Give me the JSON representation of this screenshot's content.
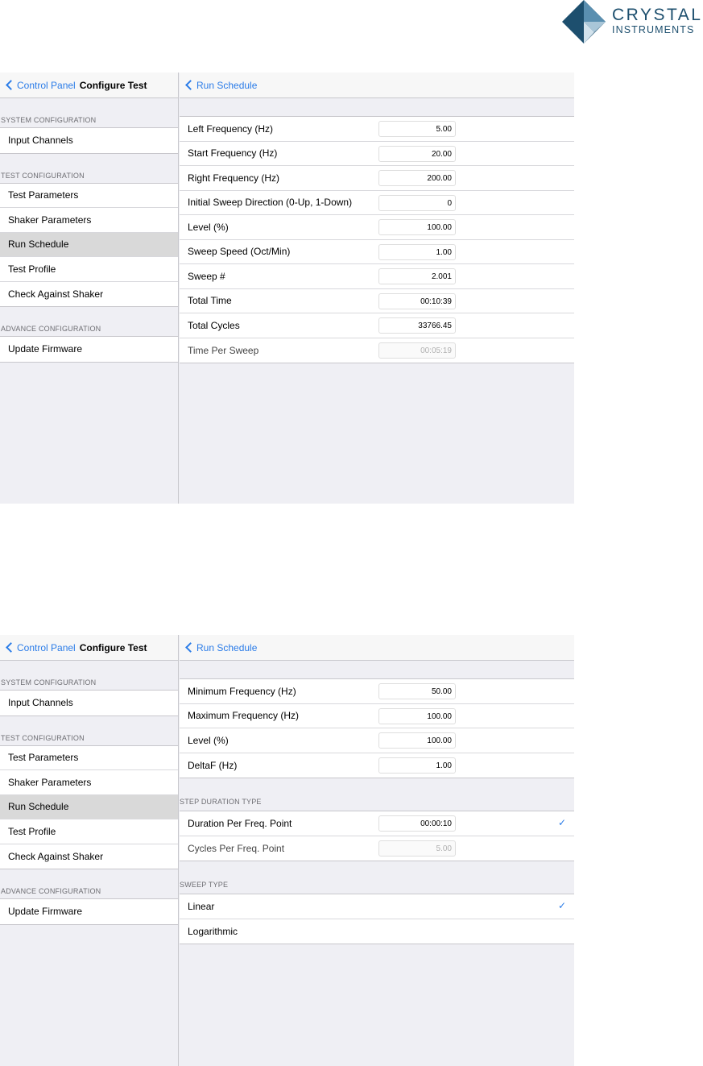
{
  "logo": {
    "line1": "CRYSTAL",
    "line2": "INSTRUMENTS"
  },
  "screens": [
    {
      "sidebar": {
        "back_label": "Control Panel",
        "title": "Configure Test",
        "sections": [
          {
            "header": "SYSTEM CONFIGURATION",
            "items": [
              "Input Channels"
            ]
          },
          {
            "header": "TEST CONFIGURATION",
            "items": [
              "Test Parameters",
              "Shaker Parameters",
              "Run Schedule",
              "Test Profile",
              "Check Against Shaker"
            ]
          },
          {
            "header": "ADVANCE CONFIGURATION",
            "items": [
              "Update Firmware"
            ]
          }
        ],
        "selected": "Run Schedule"
      },
      "detail": {
        "back_label": "Run Schedule",
        "rows": [
          {
            "label": "Left Frequency (Hz)",
            "value": "5.00"
          },
          {
            "label": "Start Frequency (Hz)",
            "value": "20.00"
          },
          {
            "label": "Right Frequency (Hz)",
            "value": "200.00"
          },
          {
            "label": "Initial Sweep Direction (0-Up, 1-Down)",
            "value": "0"
          },
          {
            "label": "Level (%)",
            "value": "100.00"
          },
          {
            "label": "Sweep Speed (Oct/Min)",
            "value": "1.00"
          },
          {
            "label": "Sweep #",
            "value": "2.001"
          },
          {
            "label": "Total Time",
            "value": "00:10:39"
          },
          {
            "label": "Total Cycles",
            "value": "33766.45"
          },
          {
            "label": "Time Per Sweep",
            "value": "00:05:19",
            "disabled": true
          }
        ]
      }
    },
    {
      "sidebar": {
        "back_label": "Control Panel",
        "title": "Configure Test",
        "sections": [
          {
            "header": "SYSTEM CONFIGURATION",
            "items": [
              "Input Channels"
            ]
          },
          {
            "header": "TEST CONFIGURATION",
            "items": [
              "Test Parameters",
              "Shaker Parameters",
              "Run Schedule",
              "Test Profile",
              "Check Against Shaker"
            ]
          },
          {
            "header": "ADVANCE CONFIGURATION",
            "items": [
              "Update Firmware"
            ]
          }
        ],
        "selected": "Run Schedule"
      },
      "detail": {
        "back_label": "Run Schedule",
        "rows": [
          {
            "label": "Minimum Frequency (Hz)",
            "value": "50.00"
          },
          {
            "label": "Maximum Frequency (Hz)",
            "value": "100.00"
          },
          {
            "label": "Level (%)",
            "value": "100.00"
          },
          {
            "label": "DeltaF (Hz)",
            "value": "1.00"
          }
        ],
        "step_duration_header": "STEP DURATION TYPE",
        "step_rows": [
          {
            "label": "Duration Per Freq. Point",
            "value": "00:00:10",
            "checked": true
          },
          {
            "label": "Cycles Per Freq. Point",
            "value": "5.00",
            "disabled": true
          }
        ],
        "sweep_type_header": "SWEEP TYPE",
        "sweep_rows": [
          {
            "label": "Linear",
            "checked": true
          },
          {
            "label": "Logarithmic"
          }
        ],
        "checkmark": "✓"
      }
    }
  ]
}
